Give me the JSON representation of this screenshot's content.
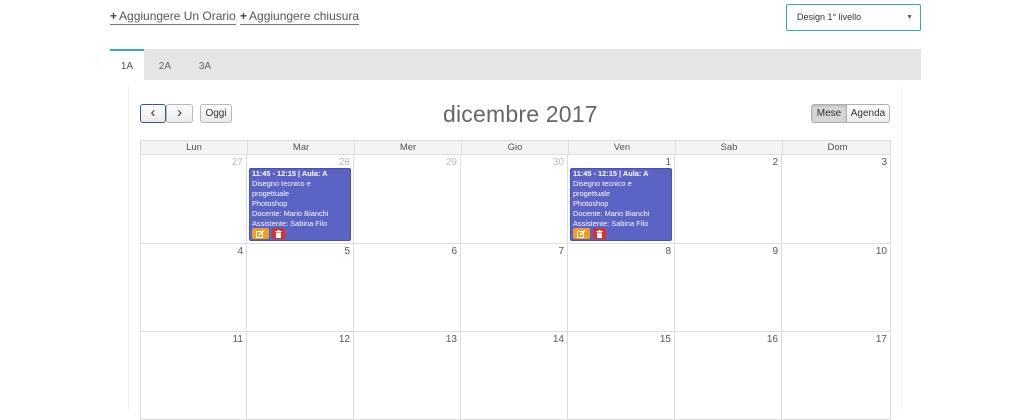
{
  "actions": {
    "add_schedule": "Aggiungere Un Orario",
    "add_closure": "Aggiungere chiusura",
    "plus_glyph": "+"
  },
  "course_select": {
    "value": "Design 1° livello",
    "caret": "▼"
  },
  "tabs": [
    {
      "label": "1A",
      "active": true
    },
    {
      "label": "2A",
      "active": false
    },
    {
      "label": "3A",
      "active": false
    }
  ],
  "toolbar": {
    "prev_glyph": "‹",
    "next_glyph": "›",
    "today_label": "Oggi",
    "title": "dicembre 2017",
    "view_month": "Mese",
    "view_agenda": "Agenda",
    "active_view": "Mese"
  },
  "weekdays": [
    "Lun",
    "Mar",
    "Mer",
    "Gio",
    "Ven",
    "Sab",
    "Dom"
  ],
  "weeks": [
    {
      "days": [
        {
          "n": "27",
          "other": true
        },
        {
          "n": "28",
          "other": true
        },
        {
          "n": "29",
          "other": true
        },
        {
          "n": "30",
          "other": true
        },
        {
          "n": "1",
          "other": false
        },
        {
          "n": "2",
          "other": false
        },
        {
          "n": "3",
          "other": false
        }
      ]
    },
    {
      "days": [
        {
          "n": "4",
          "other": false
        },
        {
          "n": "5",
          "other": false
        },
        {
          "n": "6",
          "other": false
        },
        {
          "n": "7",
          "other": false
        },
        {
          "n": "8",
          "other": false
        },
        {
          "n": "9",
          "other": false
        },
        {
          "n": "10",
          "other": false
        }
      ]
    },
    {
      "days": [
        {
          "n": "11",
          "other": false
        },
        {
          "n": "12",
          "other": false
        },
        {
          "n": "13",
          "other": false
        },
        {
          "n": "14",
          "other": false
        },
        {
          "n": "15",
          "other": false
        },
        {
          "n": "16",
          "other": false
        },
        {
          "n": "17",
          "other": false
        }
      ]
    }
  ],
  "events": [
    {
      "week": 0,
      "day": 1,
      "time": "11:45 - 12:15 | Aula: A",
      "subject": "Disegno tecnico e progettuale",
      "software": "Photoshop",
      "teacher": "Docente: Mario Bianchi",
      "assistant": "Assistente: Sabina Filo",
      "color": "#5b63c4"
    },
    {
      "week": 0,
      "day": 4,
      "time": "11:45 - 12:15 | Aula: A",
      "subject": "Disegno tecnico e progettuale",
      "software": "Photoshop",
      "teacher": "Docente: Mario Bianchi",
      "assistant": "Assistente: Sabina Filo",
      "color": "#5b63c4"
    }
  ],
  "icons": {
    "edit": "edit-icon",
    "delete": "trash-icon"
  },
  "colors": {
    "accent": "#3aa6a6",
    "event": "#5b63c4",
    "edit": "#f0a020",
    "delete": "#d9302b"
  }
}
